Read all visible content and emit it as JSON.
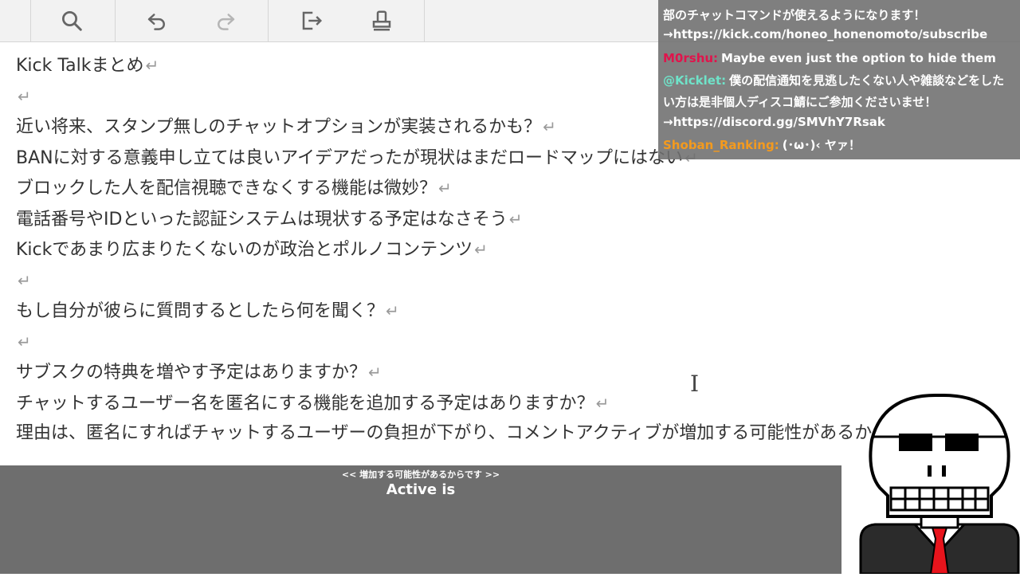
{
  "toolbar": {
    "icons": [
      "search-icon",
      "undo-icon",
      "redo-icon",
      "export-icon",
      "print-icon"
    ]
  },
  "document": {
    "return_mark": "↵",
    "lines": [
      "Kick Talkまとめ",
      "",
      "近い将来、スタンプ無しのチャットオプションが実装されるかも？",
      "BANに対する意義申し立ては良いアイデアだったが現状はまだロードマップにはない",
      "ブロックした人を配信視聴できなくする機能は微妙？",
      "電話番号やIDといった認証システムは現状する予定はなさそう",
      "Kickであまり広まりたくないのが政治とポルノコンテンツ",
      "",
      "もし自分が彼らに質問するとしたら何を聞く？",
      "",
      "サブスクの特典を増やす予定はありますか？",
      "チャットするユーザー名を匿名にする機能を追加する予定はありますか？",
      "理由は、匿名にすればチャットするユーザーの負担が下がり、コメントアクティブが増加する可能性があるからです"
    ]
  },
  "chat": {
    "messages": [
      {
        "user": "",
        "text": "部のチャットコマンドが使えるようになります！",
        "color": "#ffffff"
      },
      {
        "user": "",
        "text": "→https://kick.com/honeo_honenomoto/subscribe",
        "color": "#ffffff"
      },
      {
        "user": "M0rshu:",
        "text": "Maybe even just the option to hide them",
        "color": "#e0144c"
      },
      {
        "user": "@Kicklet:",
        "text": "僕の配信通知を見逃したくない人や雑談などをしたい方は是非個人ディスコ鯖にご参加くださいませ！",
        "color": "#6fe3c9"
      },
      {
        "user": "",
        "text": "→https://discord.gg/SMVhY7Rsak",
        "color": "#ffffff"
      },
      {
        "user": "Shoban_Ranking:",
        "text": "(･ω･)‹ ヤァ！",
        "color": "#f39a1e"
      }
    ]
  },
  "caption": {
    "top": "<< 増加する可能性があるからです >>",
    "main": "Active is"
  },
  "colors": {
    "toolbar_bg": "#f2f2f2",
    "chat_bg": "#6e6e6e",
    "caption_bg": "#6e6e6e",
    "tie": "#e8141c"
  }
}
